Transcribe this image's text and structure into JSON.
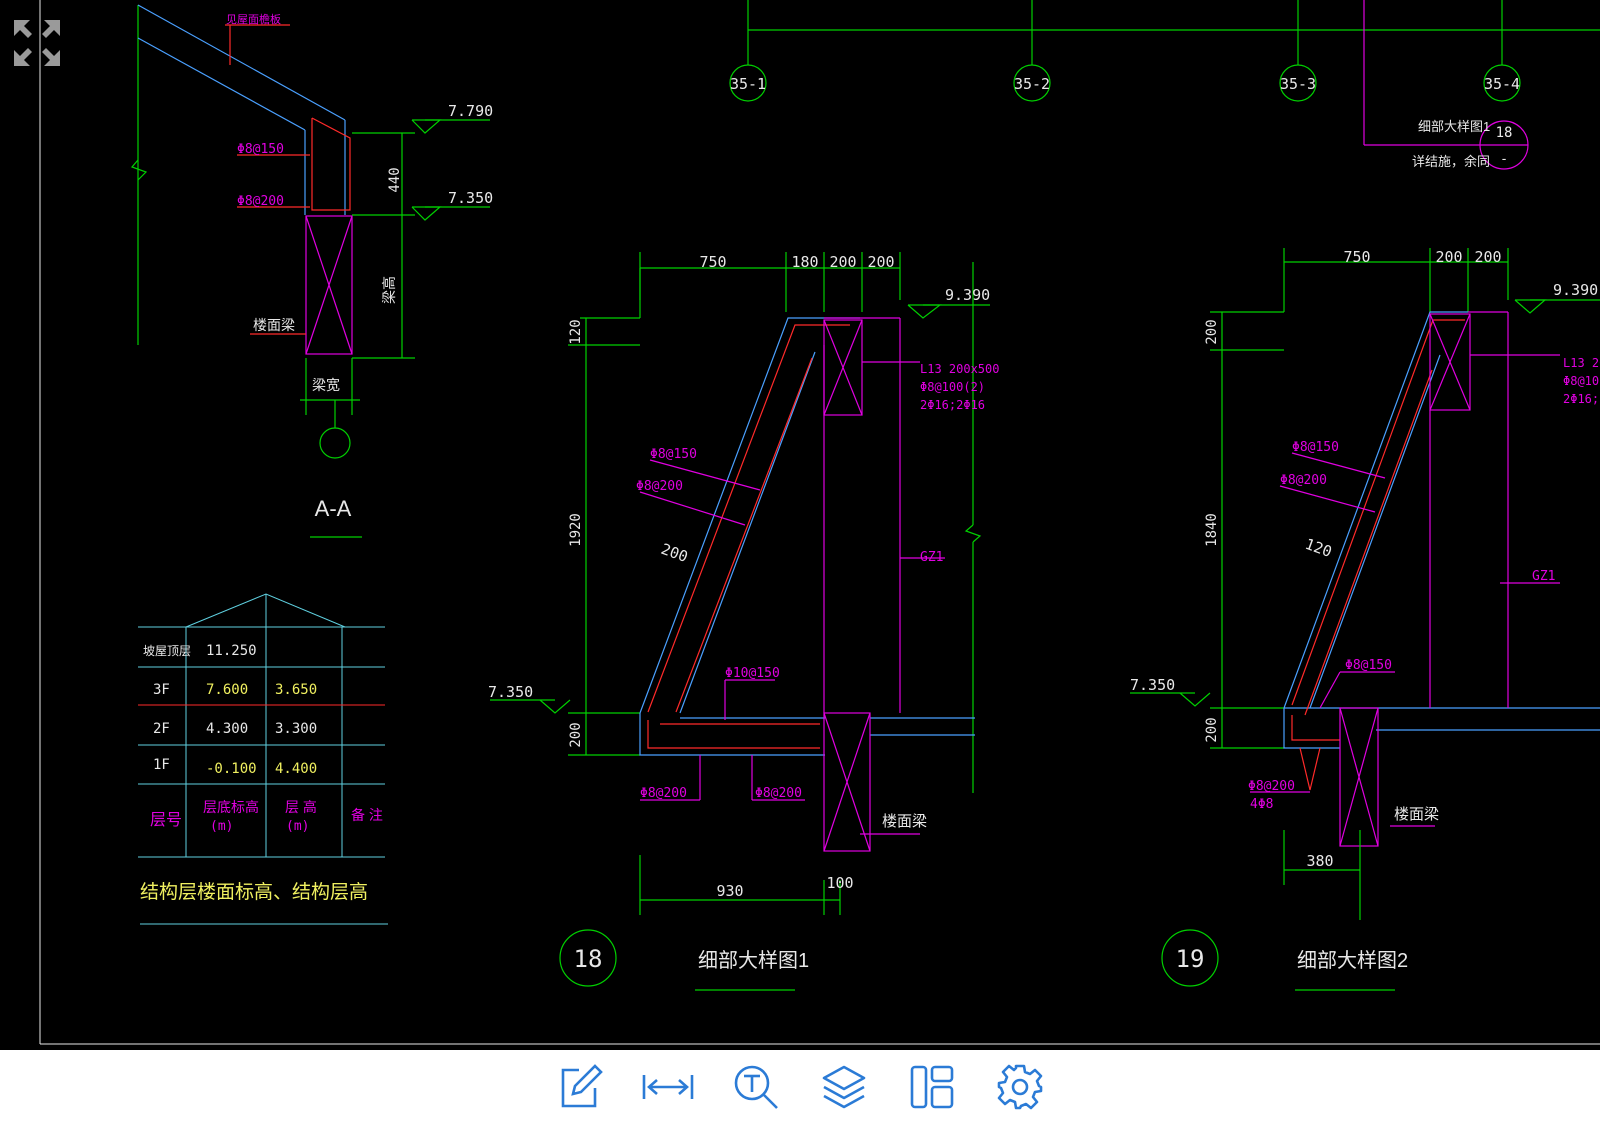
{
  "colors": {
    "background": "#000000",
    "green": "#00d000",
    "magenta": "#e000e0",
    "red": "#ff2a2a",
    "blue": "#4aa0ff",
    "yellow": "#f0f060",
    "cyan": "#5fd0e0",
    "white": "#e8e8e8",
    "toolbar_icon": "#2b7bd6"
  },
  "drawing": {
    "axis_labels": [
      "35-1",
      "35-2",
      "35-3",
      "35-4"
    ],
    "callout": {
      "title": "细部大样图1",
      "note": "详结施，余同",
      "number": "18",
      "sheet": "-"
    },
    "section_aa": {
      "title": "A-A",
      "top_note": "见屋面檐板",
      "rebar_1": "Φ8@150",
      "rebar_2": "Φ8@200",
      "elev_top": "7.790",
      "elev_mid": "7.350",
      "dim_440": "440",
      "beam_height": "梁高",
      "beam_width": "梁宽",
      "floor_beam": "楼面梁"
    },
    "floor_table": {
      "rows": [
        {
          "floor": "坡屋顶层",
          "elevation": "11.250",
          "height": ""
        },
        {
          "floor": "3F",
          "elevation": "7.600",
          "height": "3.650"
        },
        {
          "floor": "2F",
          "elevation": "4.300",
          "height": "3.300"
        },
        {
          "floor": "1F",
          "elevation": "-0.100",
          "height": "4.400"
        }
      ],
      "header_floor": "层号",
      "header_elev_1": "层底标高",
      "header_elev_2": "(m)",
      "header_height_1": "层 高",
      "header_height_2": "(m)",
      "header_note": "备 注",
      "caption": "结构层楼面标高、结构层高"
    },
    "detail_18": {
      "number": "18",
      "title": "细部大样图1",
      "dims_top": [
        "750",
        "180",
        "200",
        "200"
      ],
      "elev_top": "9.390",
      "elev_left": "7.350",
      "dim_v_120": "120",
      "dim_v_1920": "1920",
      "dim_v_200": "200",
      "beam_label_1": "L13 200x500",
      "beam_label_2": "Φ8@100(2)",
      "beam_label_3": "2Φ16;2Φ16",
      "rebar_a": "Φ8@150",
      "rebar_b": "Φ8@200",
      "thickness": "200",
      "rebar_c": "Φ10@150",
      "rebar_d": "Φ8@200",
      "rebar_e": "Φ8@200",
      "column": "GZ1",
      "floor_beam": "楼面梁",
      "dim_930": "930",
      "dim_100": "100"
    },
    "detail_19": {
      "number": "19",
      "title": "细部大样图2",
      "dims_top": [
        "750",
        "200",
        "200"
      ],
      "elev_top": "9.390",
      "elev_left": "7.350",
      "dim_v_200a": "200",
      "dim_v_1840": "1840",
      "dim_v_200b": "200",
      "beam_label_1": "L13 20",
      "beam_label_2": "Φ8@10",
      "beam_label_3": "2Φ16;2",
      "rebar_a": "Φ8@150",
      "rebar_b": "Φ8@200",
      "thickness": "120",
      "rebar_c": "Φ8@150",
      "rebar_d": "Φ8@200",
      "rebar_e": "4Φ8",
      "column": "GZ1",
      "floor_beam": "楼面梁",
      "dim_380": "380"
    }
  },
  "toolbar": {
    "items": [
      {
        "name": "edit-tool-button",
        "icon": "pencil-icon"
      },
      {
        "name": "measure-tool-button",
        "icon": "measure-arrows-icon"
      },
      {
        "name": "text-search-button",
        "icon": "text-search-icon"
      },
      {
        "name": "layers-button",
        "icon": "layers-icon"
      },
      {
        "name": "layout-button",
        "icon": "layout-icon"
      },
      {
        "name": "settings-button",
        "icon": "gear-icon"
      }
    ]
  }
}
